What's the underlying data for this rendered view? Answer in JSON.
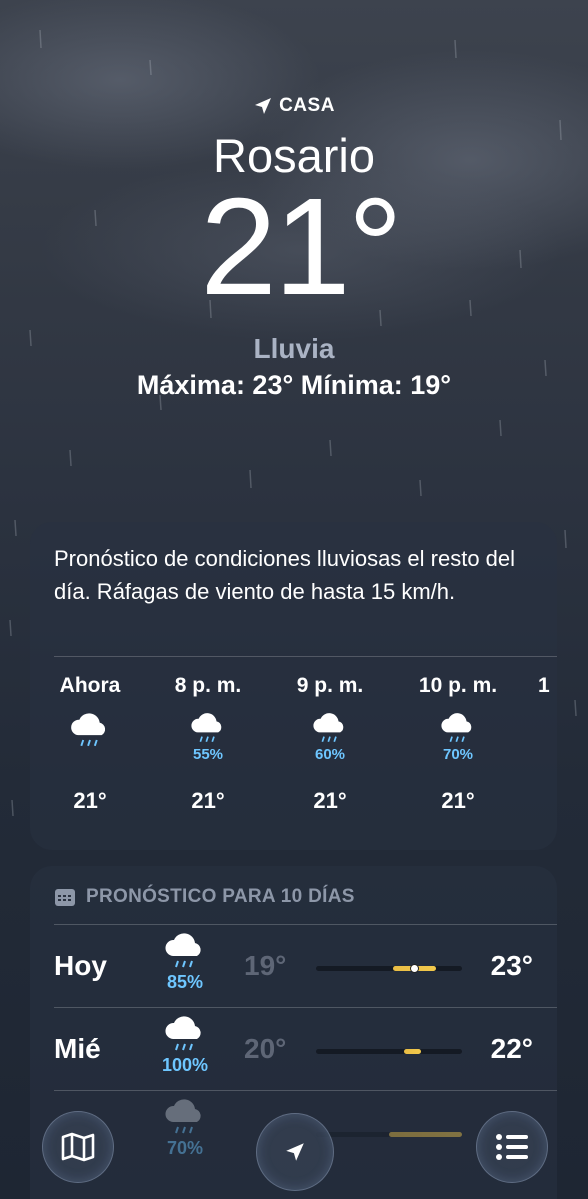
{
  "header": {
    "location_label": "CASA",
    "city": "Rosario",
    "temperature": "21°",
    "condition": "Lluvia",
    "high_low": "Máxima: 23°  Mínima: 19°"
  },
  "hourly": {
    "summary": "Pronóstico de condiciones lluviosas el resto del día. Ráfagas de viento de hasta 15 km/h.",
    "items": [
      {
        "label": "Ahora",
        "icon": "rain-cloud-icon",
        "precip": "",
        "temp": "21°"
      },
      {
        "label": "8 p. m.",
        "icon": "rain-cloud-icon",
        "precip": "55%",
        "temp": "21°"
      },
      {
        "label": "9 p. m.",
        "icon": "rain-cloud-icon",
        "precip": "60%",
        "temp": "21°"
      },
      {
        "label": "10 p. m.",
        "icon": "rain-cloud-icon",
        "precip": "70%",
        "temp": "21°"
      },
      {
        "label": "1",
        "icon": "",
        "precip": "",
        "temp": ""
      }
    ]
  },
  "daily": {
    "title": "PRONÓSTICO PARA 10 DÍAS",
    "rows": [
      {
        "day": "Hoy",
        "icon": "rain-cloud-icon",
        "precip": "85%",
        "low": "19°",
        "high": "23°",
        "range_start": 0.53,
        "range_end": 0.82,
        "current": 0.67
      },
      {
        "day": "Mié",
        "icon": "rain-cloud-icon",
        "precip": "100%",
        "low": "20°",
        "high": "22°",
        "range_start": 0.6,
        "range_end": 0.72
      },
      {
        "day": "",
        "icon": "rain-cloud-icon",
        "precip": "70%",
        "low": "",
        "high": "",
        "range_start": 0.5,
        "range_end": 1.0
      }
    ]
  },
  "colors": {
    "accent_precip": "#6ec6ff",
    "temp_bar": "#f2c94c"
  },
  "tabbar": {
    "map_icon": "map-icon",
    "location_icon": "location-arrow-icon",
    "list_icon": "list-icon"
  }
}
